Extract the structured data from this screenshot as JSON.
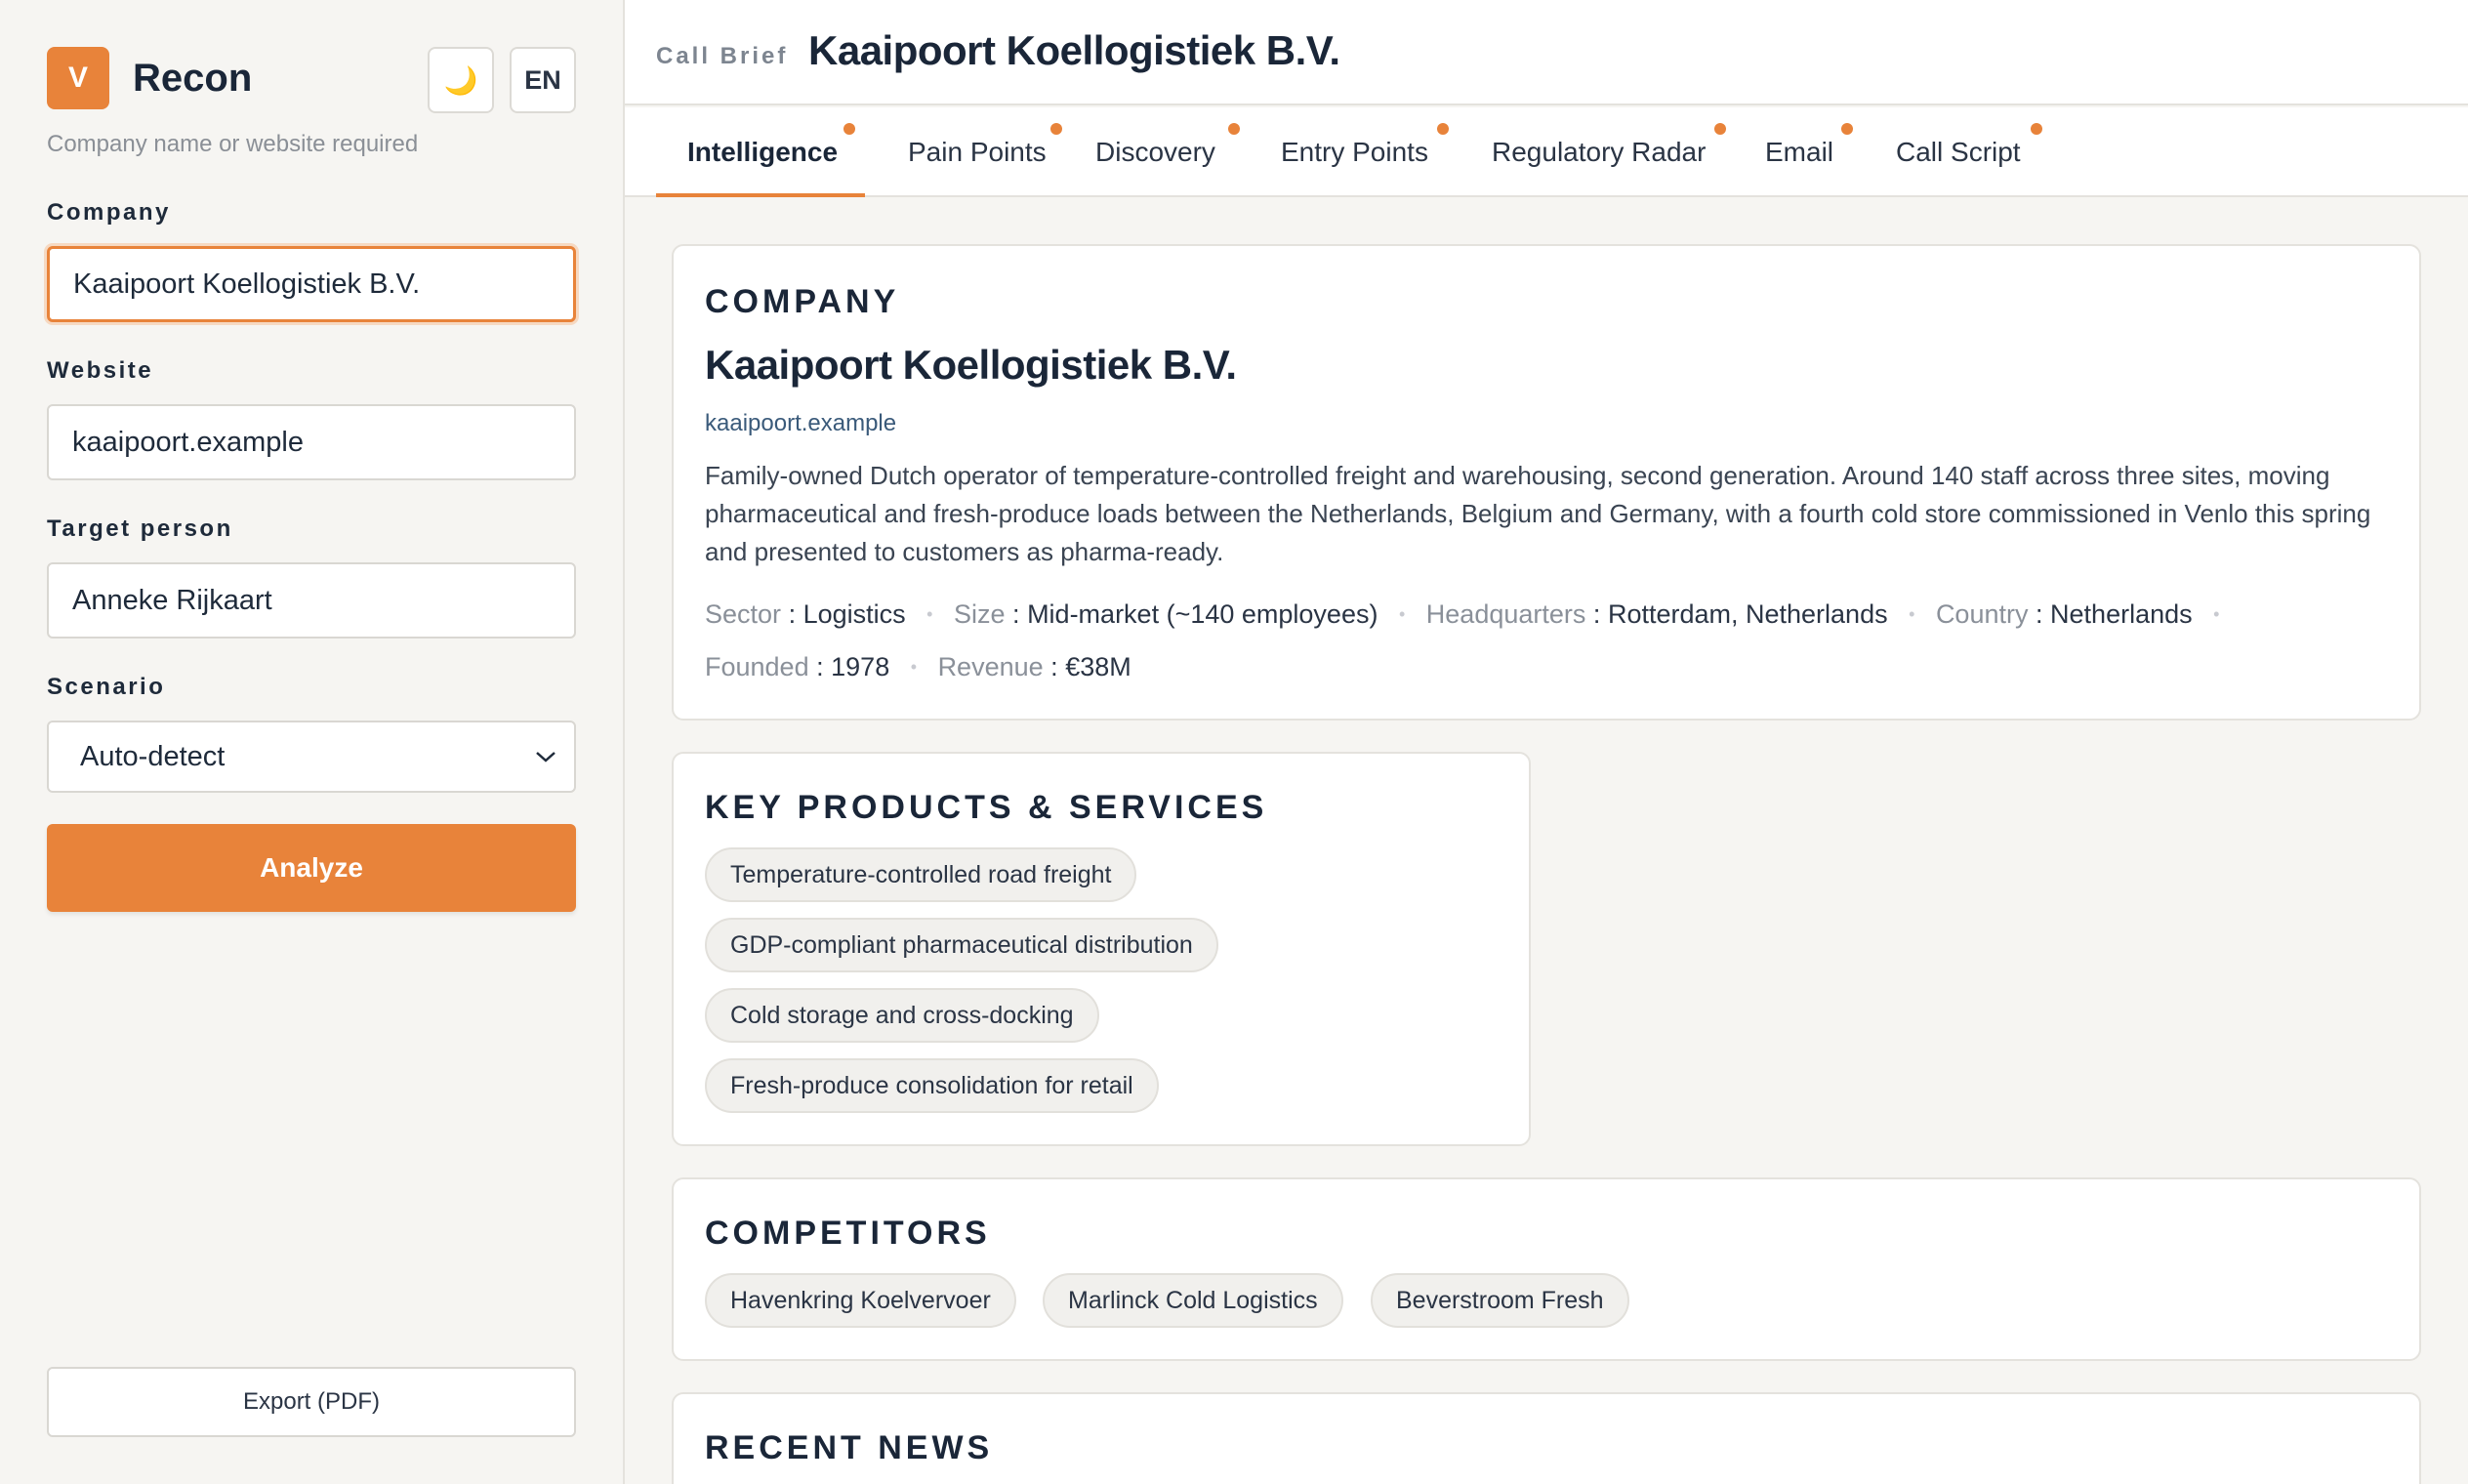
{
  "sidebar": {
    "logo_letter": "V",
    "brand_name": "Recon",
    "theme_icon": "moon-icon",
    "theme_glyph": "🌙",
    "language": "EN",
    "hint": "Company name or website required",
    "company_label": "Company",
    "company_value": "Kaaipoort Koellogistiek B.V.",
    "website_label": "Website",
    "website_value": "kaaipoort.example",
    "target_label": "Target person",
    "target_value": "Anneke Rijkaart",
    "scenario_label": "Scenario",
    "scenario_value": "Auto-detect",
    "analyze_label": "Analyze",
    "export_label": "Export (PDF)"
  },
  "header": {
    "eyebrow": "Call Brief",
    "title": "Kaaipoort Koellogistiek B.V."
  },
  "tabs": [
    {
      "label": "Intelligence",
      "active": true
    },
    {
      "label": "Pain Points"
    },
    {
      "label": "Discovery"
    },
    {
      "label": "Entry Points"
    },
    {
      "label": "Regulatory Radar"
    },
    {
      "label": "Email"
    },
    {
      "label": "Call Script"
    }
  ],
  "company": {
    "heading": "COMPANY",
    "name": "Kaaipoort Koellogistiek B.V.",
    "website": "kaaipoort.example",
    "description": "Family-owned Dutch operator of temperature-controlled freight and warehousing, second generation. Around 140 staff across three sites, moving pharmaceutical and fresh-produce loads between the Netherlands, Belgium and Germany, with a fourth cold store commissioned in Venlo this spring and presented to customers as pharma-ready.",
    "sector_key": "Sector",
    "sector": "Logistics",
    "size_key": "Size",
    "size": "Mid-market (~140 employees)",
    "hq_key": "Headquarters",
    "hq": "Rotterdam, Netherlands",
    "country_key": "Country",
    "country": "Netherlands",
    "founded_key": "Founded",
    "founded": "1978",
    "revenue_key": "Revenue",
    "revenue": "€38M",
    "separator": "•",
    "kv_colon": ":"
  },
  "products": {
    "heading": "KEY PRODUCTS & SERVICES",
    "items": [
      "Temperature-controlled road freight",
      "GDP-compliant pharmaceutical distribution",
      "Cold storage and cross-docking",
      "Fresh-produce consolidation for retail"
    ]
  },
  "competitors": {
    "heading": "COMPETITORS",
    "items": [
      "Havenkring Koelvervoer",
      "Marlinck Cold Logistics",
      "Beverstroom Fresh"
    ]
  },
  "news": {
    "heading": "RECENT NEWS"
  },
  "colors": {
    "accent": "#e8833a",
    "text": "#1e2a3a",
    "background": "#f6f5f2"
  }
}
